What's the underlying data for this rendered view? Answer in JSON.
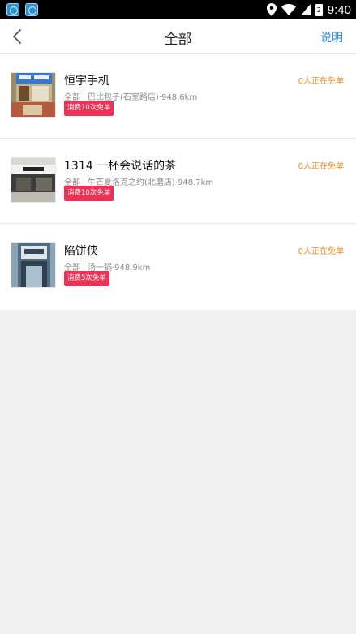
{
  "status_bar": {
    "time": "9:40",
    "battery_label": "2",
    "icons": [
      "app-icon-1",
      "app-icon-2",
      "location-icon",
      "wifi-icon",
      "signal-icon",
      "battery-icon"
    ]
  },
  "header": {
    "title": "全部",
    "help_label": "说明",
    "back_icon": "chevron-left-icon"
  },
  "colors": {
    "accent_blue": "#2a8ee0",
    "badge_red": "#ef3155",
    "free_orange": "#f08a24"
  },
  "shops": [
    {
      "name": "恒宇手机",
      "category": "全部",
      "branch": "巴比包子(石室路店)",
      "distance": "·948.6km",
      "badge": "消费10次免单",
      "free_count": "0人正在免单"
    },
    {
      "name": "1314 一杯会说话的茶",
      "category": "全部",
      "branch": "牛芒夏洛克之约(北磨店)",
      "distance": "·948.7km",
      "badge": "消费10次免单",
      "free_count": "0人正在免单"
    },
    {
      "name": "陷饼侠",
      "category": "全部",
      "branch": "汤一锅",
      "distance": "·948.9km",
      "badge": "消费5次免单",
      "free_count": "0人正在免单"
    }
  ]
}
